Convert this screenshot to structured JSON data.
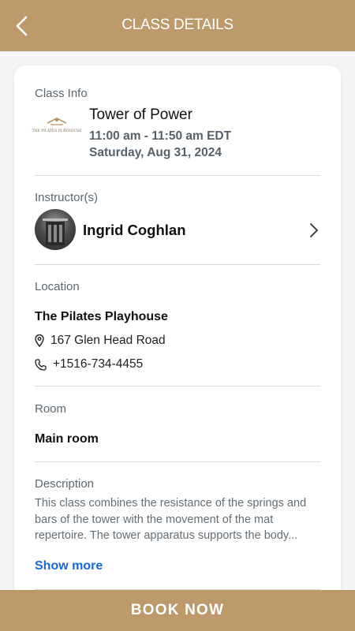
{
  "header": {
    "title": "CLASS DETAILS",
    "back_icon": "chevron-left-icon"
  },
  "class_info": {
    "label": "Class Info",
    "logo_text": "THE PILATES PLAYHOUSE",
    "name": "Tower of Power",
    "time": "11:00 am - 11:50 am EDT",
    "date": "Saturday, Aug 31, 2024"
  },
  "instructor": {
    "label": "Instructor(s)",
    "name": "Ingrid Coghlan"
  },
  "location": {
    "label": "Location",
    "name": "The Pilates Playhouse",
    "address": "167 Glen Head Road",
    "phone": "+1516-734-4455"
  },
  "room": {
    "label": "Room",
    "name": "Main room"
  },
  "description": {
    "label": "Description",
    "text": "This class combines the resistance of the springs and bars of the tower with the movement of the mat repertoire.  The tower apparatus supports the body...",
    "show_more": "Show more"
  },
  "book_button": {
    "label": "BOOK NOW"
  },
  "colors": {
    "brand": "#bd9a6b",
    "link": "#1967d2"
  }
}
